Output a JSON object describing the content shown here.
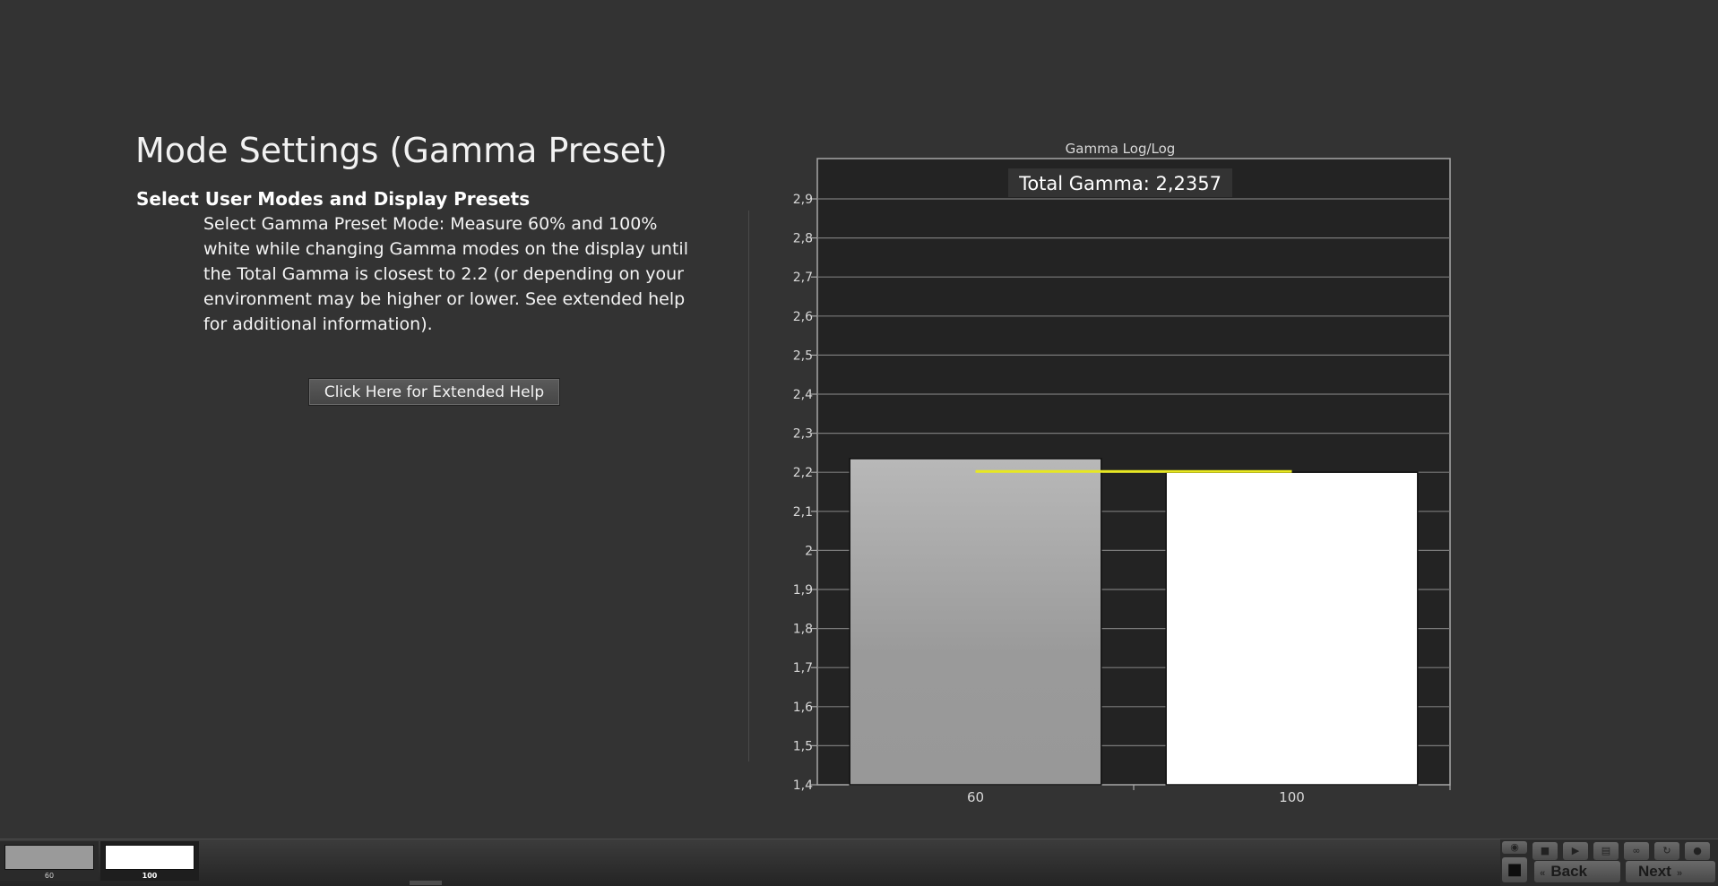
{
  "page": {
    "title": "Mode Settings (Gamma Preset)",
    "section_heading": "Select User Modes and Display Presets",
    "instructions": "Select Gamma Preset Mode: Measure 60% and 100% white while changing Gamma modes on the display until the Total Gamma is closest to 2.2 (or depending on your environment may be higher or lower. See extended help for additional information).",
    "help_button_label": "Click Here for Extended Help"
  },
  "chart_data": {
    "type": "bar",
    "title": "Gamma Log/Log",
    "annotation": "Total Gamma: 2,2357",
    "categories": [
      "60",
      "100"
    ],
    "values": [
      2.235,
      2.2
    ],
    "bar_colors": [
      "#a8a8a8",
      "#ffffff"
    ],
    "target_line": {
      "value": 2.2,
      "color": "#e8e820"
    },
    "ylim": [
      1.4,
      2.9
    ],
    "yticks": [
      "1,4",
      "1,5",
      "1,6",
      "1,7",
      "1,8",
      "1,9",
      "2",
      "2,1",
      "2,2",
      "2,3",
      "2,4",
      "2,5",
      "2,6",
      "2,7",
      "2,8",
      "2,9"
    ],
    "xlabel": "",
    "ylabel": "",
    "grid": true
  },
  "bottom_bar": {
    "swatches": [
      {
        "label": "60",
        "color": "#9a9a9a",
        "selected": false
      },
      {
        "label": "100",
        "color": "#ffffff",
        "selected": true
      }
    ],
    "control_icons": [
      "eye-icon",
      "stop-icon",
      "play-icon",
      "save-icon",
      "loop-icon",
      "refresh-icon",
      "dot-icon"
    ],
    "back_label": "Back",
    "next_label": "Next"
  }
}
